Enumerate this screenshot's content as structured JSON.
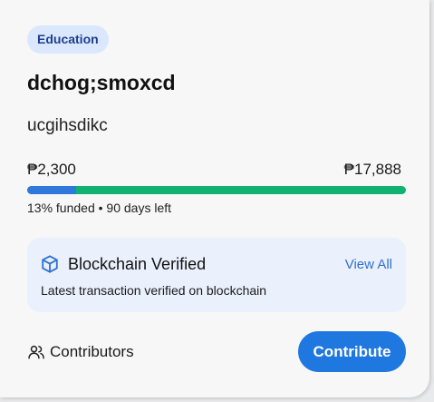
{
  "campaign": {
    "category": "Education",
    "title": "dchog;smoxcd",
    "description": "ucgihsdikc",
    "raised": "₱2,300",
    "goal": "₱17,888",
    "funded_fraction": 0.13,
    "progress_text": "13% funded • 90 days left"
  },
  "blockchain": {
    "icon": "cube-icon",
    "title": "Blockchain Verified",
    "view_all_label": "View All",
    "description": "Latest transaction verified on blockchain"
  },
  "footer": {
    "contributors_icon": "users-icon",
    "contributors_label": "Contributors",
    "contribute_label": "Contribute"
  },
  "colors": {
    "accent": "#1f77e0",
    "progress_funded": "#2f78dc",
    "progress_track": "#10b26f",
    "badge_bg": "#dbe7fc",
    "verified_bg": "#eaf1fd"
  }
}
